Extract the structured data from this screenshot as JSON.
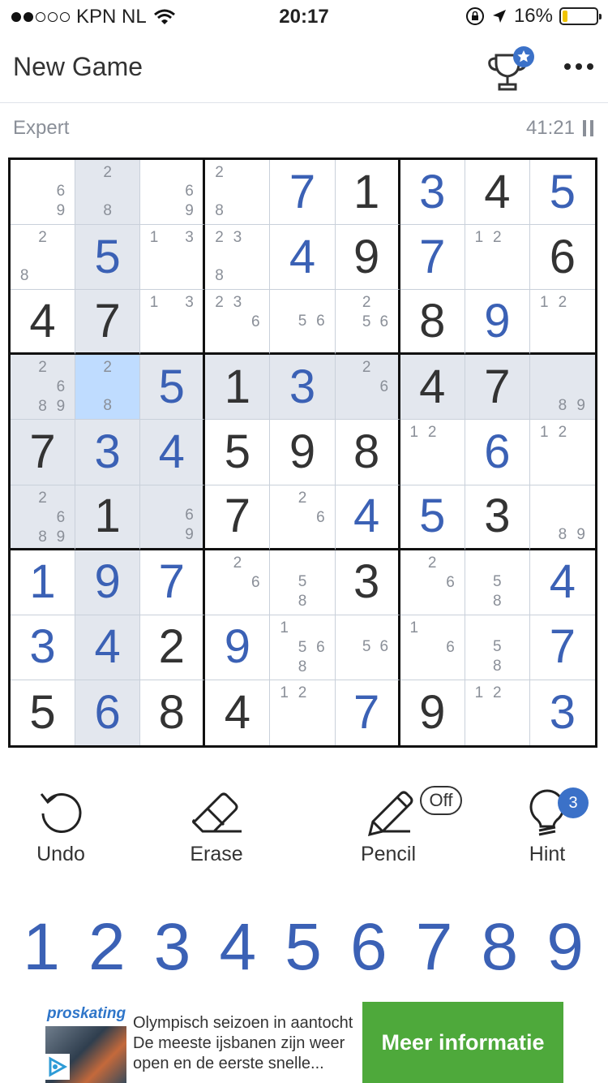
{
  "status_bar": {
    "carrier": "KPN NL",
    "time": "20:17",
    "battery": "16%",
    "battery_fraction": 0.16,
    "battery_color": "#f0c400"
  },
  "header": {
    "title": "New Game",
    "trophy_icon": "trophy-star-icon",
    "more_icon": "more-dots-icon"
  },
  "game_info": {
    "difficulty": "Expert",
    "timer": "41:21"
  },
  "board": {
    "highlight_color": "#e3e7ee",
    "selected_color": "#bfdcff",
    "user_digit_color": "#3b61b5",
    "rows": [
      [
        {
          "notes": [
            "",
            "",
            "",
            "",
            "",
            "6",
            "",
            "",
            "9"
          ],
          "hl": false
        },
        {
          "notes": [
            "",
            "2",
            "",
            "",
            "",
            "",
            "",
            "8",
            ""
          ],
          "hl": true
        },
        {
          "notes": [
            "",
            "",
            "",
            "",
            "",
            "6",
            "",
            "",
            "9"
          ],
          "hl": false
        },
        {
          "notes": [
            "2",
            "",
            "",
            "",
            "",
            "",
            "8",
            "",
            ""
          ],
          "hl": false
        },
        {
          "v": "7",
          "user": true,
          "hl": false
        },
        {
          "v": "1",
          "user": false,
          "hl": false
        },
        {
          "v": "3",
          "user": true,
          "hl": false
        },
        {
          "v": "4",
          "user": false,
          "hl": false
        },
        {
          "v": "5",
          "user": true,
          "hl": false
        }
      ],
      [
        {
          "notes": [
            "",
            "2",
            "",
            "",
            "",
            "",
            "8",
            "",
            ""
          ],
          "hl": false
        },
        {
          "v": "5",
          "user": true,
          "hl": true
        },
        {
          "notes": [
            "1",
            "",
            "3",
            "",
            "",
            "",
            "",
            "",
            ""
          ],
          "hl": false
        },
        {
          "notes": [
            "2",
            "3",
            "",
            "",
            "",
            "",
            "8",
            "",
            ""
          ],
          "hl": false
        },
        {
          "v": "4",
          "user": true,
          "hl": false
        },
        {
          "v": "9",
          "user": false,
          "hl": false
        },
        {
          "v": "7",
          "user": true,
          "hl": false
        },
        {
          "notes": [
            "1",
            "2",
            "",
            "",
            "",
            "",
            "",
            "",
            ""
          ],
          "hl": false
        },
        {
          "v": "6",
          "user": false,
          "hl": false
        }
      ],
      [
        {
          "v": "4",
          "user": false,
          "hl": false
        },
        {
          "v": "7",
          "user": false,
          "hl": true
        },
        {
          "notes": [
            "1",
            "",
            "3",
            "",
            "",
            "",
            "",
            "",
            ""
          ],
          "hl": false
        },
        {
          "notes": [
            "2",
            "3",
            "",
            "",
            "",
            "6",
            "",
            "",
            ""
          ],
          "hl": false
        },
        {
          "notes": [
            "",
            "",
            "",
            "",
            "5",
            "6",
            "",
            "",
            ""
          ],
          "hl": false
        },
        {
          "notes": [
            "",
            "2",
            "",
            "",
            "5",
            "6",
            "",
            "",
            ""
          ],
          "hl": false
        },
        {
          "v": "8",
          "user": false,
          "hl": false
        },
        {
          "v": "9",
          "user": true,
          "hl": false
        },
        {
          "notes": [
            "1",
            "2",
            "",
            "",
            "",
            "",
            "",
            "",
            ""
          ],
          "hl": false
        }
      ],
      [
        {
          "notes": [
            "",
            "2",
            "",
            "",
            "",
            "6",
            "",
            "8",
            "9"
          ],
          "hl": true
        },
        {
          "notes": [
            "",
            "2",
            "",
            "",
            "",
            "",
            "",
            "8",
            ""
          ],
          "hl": true,
          "sel": true
        },
        {
          "v": "5",
          "user": true,
          "hl": true
        },
        {
          "v": "1",
          "user": false,
          "hl": true
        },
        {
          "v": "3",
          "user": true,
          "hl": true
        },
        {
          "notes": [
            "",
            "2",
            "",
            "",
            "",
            "6",
            "",
            "",
            ""
          ],
          "hl": true
        },
        {
          "v": "4",
          "user": false,
          "hl": true
        },
        {
          "v": "7",
          "user": false,
          "hl": true
        },
        {
          "notes": [
            "",
            "",
            "",
            "",
            "",
            "",
            "",
            "8",
            "9"
          ],
          "hl": true
        }
      ],
      [
        {
          "v": "7",
          "user": false,
          "hl": true
        },
        {
          "v": "3",
          "user": true,
          "hl": true
        },
        {
          "v": "4",
          "user": true,
          "hl": true
        },
        {
          "v": "5",
          "user": false,
          "hl": false
        },
        {
          "v": "9",
          "user": false,
          "hl": false
        },
        {
          "v": "8",
          "user": false,
          "hl": false
        },
        {
          "notes": [
            "1",
            "2",
            "",
            "",
            "",
            "",
            "",
            "",
            ""
          ],
          "hl": false
        },
        {
          "v": "6",
          "user": true,
          "hl": false
        },
        {
          "notes": [
            "1",
            "2",
            "",
            "",
            "",
            "",
            "",
            "",
            ""
          ],
          "hl": false
        }
      ],
      [
        {
          "notes": [
            "",
            "2",
            "",
            "",
            "",
            "6",
            "",
            "8",
            "9"
          ],
          "hl": true
        },
        {
          "v": "1",
          "user": false,
          "hl": true
        },
        {
          "notes": [
            "",
            "",
            "",
            "",
            "",
            "6",
            "",
            "",
            "9"
          ],
          "hl": true
        },
        {
          "v": "7",
          "user": false,
          "hl": false
        },
        {
          "notes": [
            "",
            "2",
            "",
            "",
            "",
            "6",
            "",
            "",
            ""
          ],
          "hl": false
        },
        {
          "v": "4",
          "user": true,
          "hl": false
        },
        {
          "v": "5",
          "user": true,
          "hl": false
        },
        {
          "v": "3",
          "user": false,
          "hl": false
        },
        {
          "notes": [
            "",
            "",
            "",
            "",
            "",
            "",
            "",
            "8",
            "9"
          ],
          "hl": false
        }
      ],
      [
        {
          "v": "1",
          "user": true,
          "hl": false
        },
        {
          "v": "9",
          "user": true,
          "hl": true
        },
        {
          "v": "7",
          "user": true,
          "hl": false
        },
        {
          "notes": [
            "",
            "2",
            "",
            "",
            "",
            "6",
            "",
            "",
            ""
          ],
          "hl": false
        },
        {
          "notes": [
            "",
            "",
            "",
            "",
            "5",
            "",
            "",
            "8",
            ""
          ],
          "hl": false
        },
        {
          "v": "3",
          "user": false,
          "hl": false
        },
        {
          "notes": [
            "",
            "2",
            "",
            "",
            "",
            "6",
            "",
            "",
            ""
          ],
          "hl": false
        },
        {
          "notes": [
            "",
            "",
            "",
            "",
            "5",
            "",
            "",
            "8",
            ""
          ],
          "hl": false
        },
        {
          "v": "4",
          "user": true,
          "hl": false
        }
      ],
      [
        {
          "v": "3",
          "user": true,
          "hl": false
        },
        {
          "v": "4",
          "user": true,
          "hl": true
        },
        {
          "v": "2",
          "user": false,
          "hl": false
        },
        {
          "v": "9",
          "user": true,
          "hl": false
        },
        {
          "notes": [
            "1",
            "",
            "",
            "",
            "5",
            "6",
            "",
            "8",
            ""
          ],
          "hl": false
        },
        {
          "notes": [
            "",
            "",
            "",
            "",
            "5",
            "6",
            "",
            "",
            ""
          ],
          "hl": false
        },
        {
          "notes": [
            "1",
            "",
            "",
            "",
            "",
            "6",
            "",
            "",
            ""
          ],
          "hl": false
        },
        {
          "notes": [
            "",
            "",
            "",
            "",
            "5",
            "",
            "",
            "8",
            ""
          ],
          "hl": false
        },
        {
          "v": "7",
          "user": true,
          "hl": false
        }
      ],
      [
        {
          "v": "5",
          "user": false,
          "hl": false
        },
        {
          "v": "6",
          "user": true,
          "hl": true
        },
        {
          "v": "8",
          "user": false,
          "hl": false
        },
        {
          "v": "4",
          "user": false,
          "hl": false
        },
        {
          "notes": [
            "1",
            "2",
            "",
            "",
            "",
            "",
            "",
            "",
            ""
          ],
          "hl": false
        },
        {
          "v": "7",
          "user": true,
          "hl": false
        },
        {
          "v": "9",
          "user": false,
          "hl": false
        },
        {
          "notes": [
            "1",
            "2",
            "",
            "",
            "",
            "",
            "",
            "",
            ""
          ],
          "hl": false
        },
        {
          "v": "3",
          "user": true,
          "hl": false
        }
      ]
    ]
  },
  "tools": {
    "undo": "Undo",
    "erase": "Erase",
    "pencil": "Pencil",
    "pencil_state": "Off",
    "hint": "Hint",
    "hint_count": "3"
  },
  "numpad": [
    "1",
    "2",
    "3",
    "4",
    "5",
    "6",
    "7",
    "8",
    "9"
  ],
  "ad": {
    "brand": "proskating",
    "line1": "Olympisch seizoen in aantocht",
    "line2": "De meeste ijsbanen zijn weer",
    "line3": "open en de eerste snelle...",
    "button": "Meer informatie",
    "button_color": "#4ea93b"
  }
}
